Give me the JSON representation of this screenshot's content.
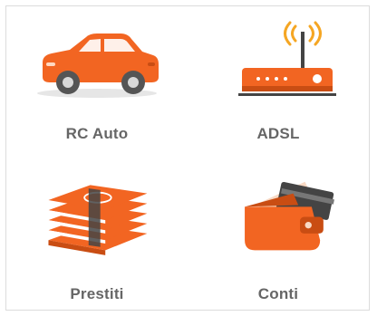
{
  "colors": {
    "accent": "#f26522",
    "accent_dark": "#c94d13",
    "label": "#666666",
    "border": "#dcdcdc"
  },
  "tiles": [
    {
      "label": "RC Auto",
      "icon": "car-icon"
    },
    {
      "label": "ADSL",
      "icon": "router-icon"
    },
    {
      "label": "Prestiti",
      "icon": "money-stack-icon"
    },
    {
      "label": "Conti",
      "icon": "wallet-icon"
    }
  ]
}
